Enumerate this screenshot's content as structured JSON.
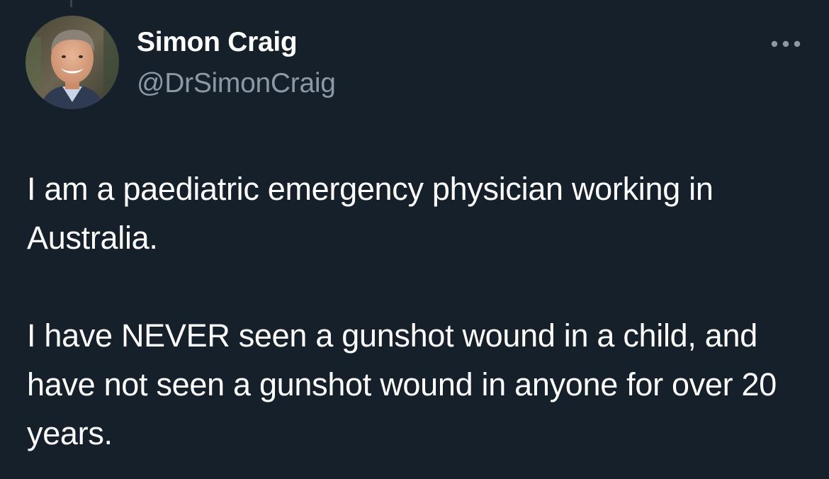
{
  "author": {
    "display_name": "Simon Craig",
    "handle": "@DrSimonCraig",
    "avatar_icon": "profile-photo-man"
  },
  "more_icon": "ellipsis-icon",
  "tweet": {
    "paragraphs": [
      "I am a paediatric emergency physician working in Australia.",
      "I have NEVER seen a gunshot wound in a child, and have not seen a gunshot wound in anyone for over 20 years."
    ]
  },
  "colors": {
    "background": "#15202b",
    "text_primary": "#ffffff",
    "text_secondary": "#8b98a5"
  }
}
